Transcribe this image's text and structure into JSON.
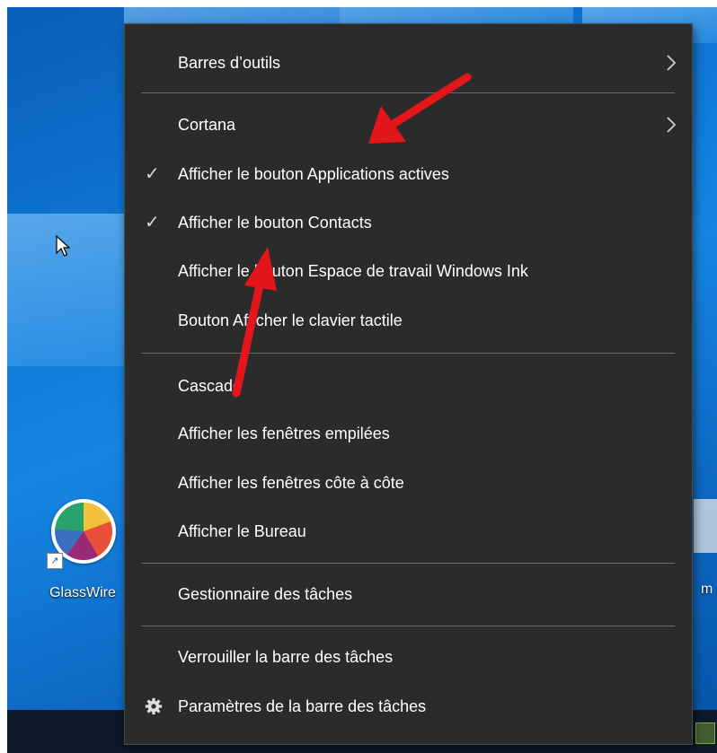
{
  "desktop": {
    "icons": [
      {
        "label": "GlassWire"
      }
    ],
    "partial_label_right": "m"
  },
  "menu": {
    "items": [
      {
        "label": "Barres d’outils",
        "submenu": true
      },
      {
        "label": "Cortana",
        "submenu": true
      },
      {
        "label": "Afficher le bouton Applications actives",
        "checked": true
      },
      {
        "label": "Afficher le bouton Contacts",
        "checked": true
      },
      {
        "label": "Afficher le bouton Espace de travail Windows Ink"
      },
      {
        "label": "Bouton Afficher le clavier tactile"
      },
      {
        "label": "Cascade"
      },
      {
        "label": "Afficher les fenêtres empilées"
      },
      {
        "label": "Afficher les fenêtres côte à côte"
      },
      {
        "label": "Afficher le Bureau"
      },
      {
        "label": "Gestionnaire des tâches"
      },
      {
        "label": "Verrouiller la barre des tâches"
      },
      {
        "label": "Paramètres de la barre des tâches",
        "icon": "gear-icon"
      }
    ]
  },
  "colors": {
    "menu_background": "#2b2b2b",
    "menu_text": "#ffffff",
    "separator": "#6b6b6b",
    "annotation_arrow": "#e3161b"
  }
}
